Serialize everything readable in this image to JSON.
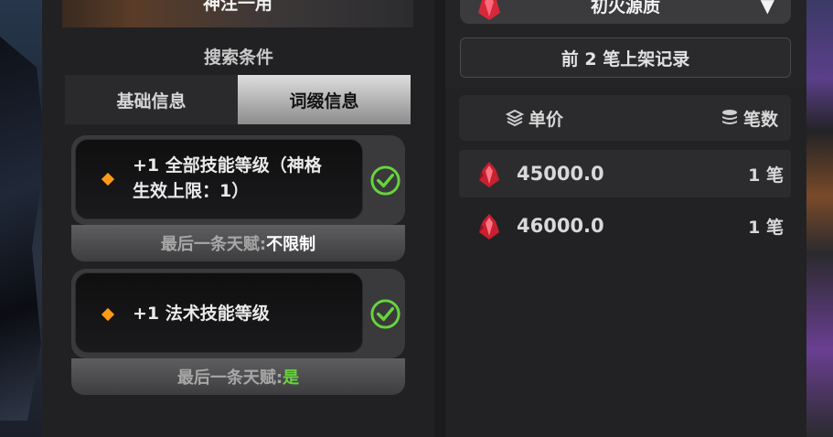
{
  "left": {
    "top_button_label": "神注一用",
    "search_title": "搜索条件",
    "tabs": [
      {
        "label": "基础信息",
        "active": false
      },
      {
        "label": "词缀信息",
        "active": true
      }
    ],
    "affixes": [
      {
        "line1": "+1 全部技能等级（神格",
        "line2": "生效上限：1）",
        "checked": true,
        "talent_label": "最后一条天赋:",
        "talent_value": "不限制"
      },
      {
        "line1": "+1 法术技能等级",
        "line2": "",
        "checked": true,
        "talent_label": "最后一条天赋:",
        "talent_value": "是"
      }
    ]
  },
  "right": {
    "currency_select": "初火源质",
    "records_label": "前 2 笔上架记录",
    "header": {
      "price": "单价",
      "count": "笔数"
    },
    "listings": [
      {
        "price": "45000.0",
        "count": "1 笔"
      },
      {
        "price": "46000.0",
        "count": "1 笔"
      }
    ]
  },
  "colors": {
    "accent_orange": "#ff9a16",
    "check_green": "#67d53b",
    "crystal_red": "#d6283a"
  }
}
